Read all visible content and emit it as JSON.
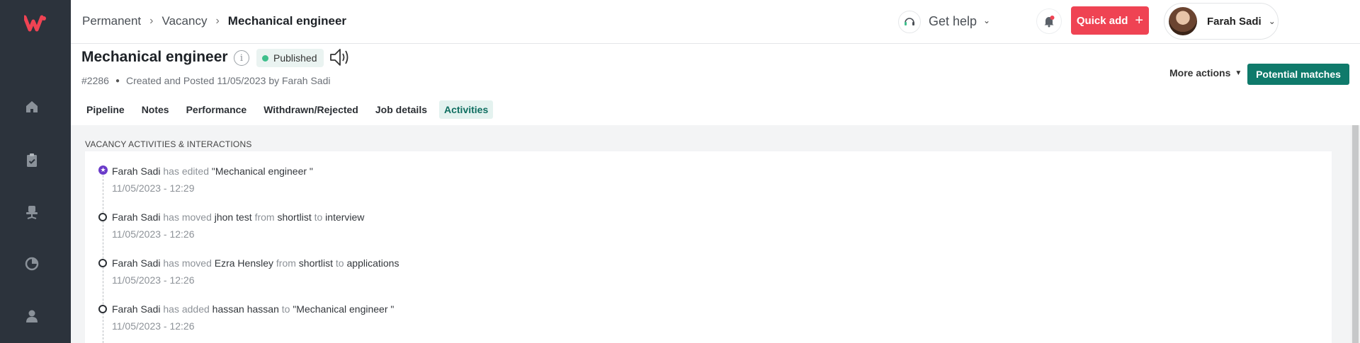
{
  "breadcrumb": {
    "items": [
      "Permanent",
      "Vacancy"
    ],
    "current": "Mechanical engineer"
  },
  "header": {
    "help_label": "Get help",
    "quick_add_label": "Quick add",
    "user_name": "Farah Sadi"
  },
  "vacancy": {
    "title": "Mechanical engineer",
    "status": "Published",
    "id": "#2286",
    "meta": "Created and Posted 11/05/2023 by Farah Sadi",
    "more_actions_label": "More actions",
    "potential_matches_label": "Potential matches"
  },
  "tabs": [
    {
      "label": "Pipeline",
      "active": false
    },
    {
      "label": "Notes",
      "active": false
    },
    {
      "label": "Performance",
      "active": false
    },
    {
      "label": "Withdrawn/Rejected",
      "active": false
    },
    {
      "label": "Job details",
      "active": false
    },
    {
      "label": "Activities",
      "active": true
    }
  ],
  "activities": {
    "section_title": "VACANCY ACTIVITIES & INTERACTIONS",
    "items": [
      {
        "actor": "Farah Sadi",
        "verb": "has edited",
        "target": "\"Mechanical engineer \"",
        "from_word": "",
        "from": "",
        "to_word": "",
        "to": "",
        "time": "11/05/2023 - 12:29",
        "icon": "star-icon"
      },
      {
        "actor": "Farah Sadi",
        "verb": "has moved",
        "target": "jhon test",
        "from_word": "from",
        "from": "shortlist",
        "to_word": "to",
        "to": "interview",
        "time": "11/05/2023 - 12:26",
        "icon": "circle-icon"
      },
      {
        "actor": "Farah Sadi",
        "verb": "has moved",
        "target": "Ezra Hensley",
        "from_word": "from",
        "from": "shortlist",
        "to_word": "to",
        "to": "applications",
        "time": "11/05/2023 - 12:26",
        "icon": "circle-icon"
      },
      {
        "actor": "Farah Sadi",
        "verb": "has added",
        "target": "hassan hassan",
        "from_word": "",
        "from": "",
        "to_word": "to",
        "to": "\"Mechanical engineer \"",
        "time": "11/05/2023 - 12:26",
        "icon": "circle-icon"
      }
    ]
  },
  "colors": {
    "sidebar": "#2c333c",
    "brand_red": "#ef4353",
    "accent_green": "#0f7a6b",
    "published_dot": "#3fbf8c",
    "edit_marker": "#6a3bc9"
  },
  "icons": {
    "logo": "brand-logo-icon",
    "sidebar": [
      "home-icon",
      "clipboard-check-icon",
      "office-chair-icon",
      "pie-chart-icon",
      "people-icon"
    ],
    "help": "headset-icon",
    "notifications": "bell-icon",
    "info": "info-icon",
    "speaker": "speaker-icon"
  }
}
